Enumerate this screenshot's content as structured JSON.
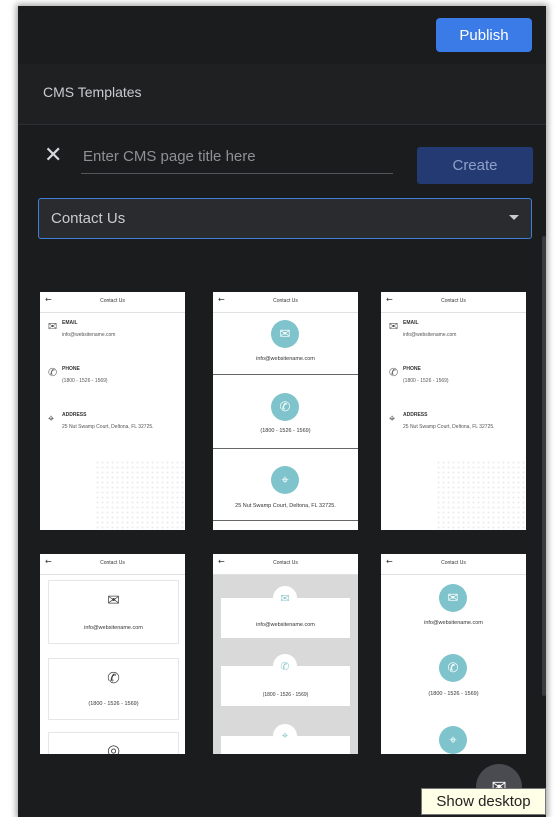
{
  "header": {
    "publish_label": "Publish"
  },
  "section": {
    "title": "CMS Templates"
  },
  "form": {
    "close_icon": "close-icon",
    "title_placeholder": "Enter CMS page title here",
    "create_label": "Create",
    "template_selected": "Contact Us"
  },
  "templates": {
    "header_title": "Contact Us",
    "email_label": "EMAIL",
    "email_value": "info@websitename.com",
    "phone_label": "PHONE",
    "phone_value": "(1800 - 1526 - 1569)",
    "address_label": "ADDRESS",
    "address_value": "25 Nut Swamp Court, Deltona, FL 32725.",
    "address_short": "25 Nut Swamp Court, Deltona, FL 32725."
  },
  "colors": {
    "accent": "#3a7be8",
    "teal": "#7fc4cc",
    "bg": "#1b1c1e"
  },
  "footer": {
    "tooltip": "Show desktop"
  }
}
